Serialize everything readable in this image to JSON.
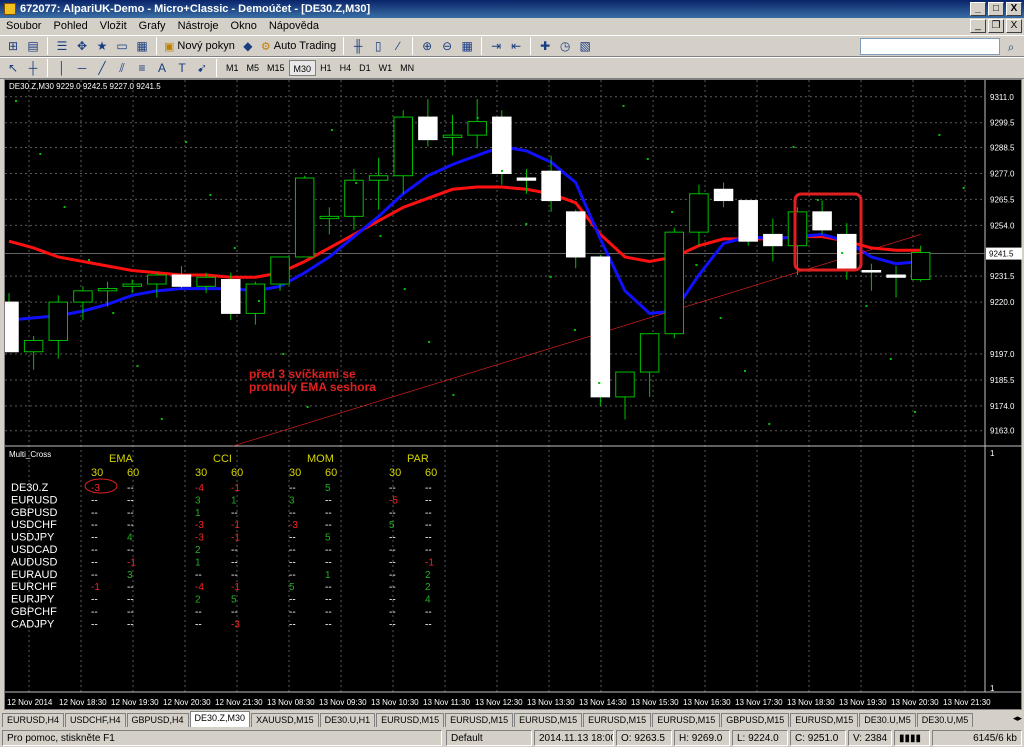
{
  "window": {
    "title": "672077: AlpariUK-Demo - Micro+Classic - Demoúčet - [DE30.Z,M30]",
    "btn_min": "_",
    "btn_max": "□",
    "btn_close": "X",
    "mdi_min": "_",
    "mdi_restore": "❐",
    "mdi_close": "X"
  },
  "menu": [
    "Soubor",
    "Pohled",
    "Vložit",
    "Grafy",
    "Nástroje",
    "Okno",
    "Nápověda"
  ],
  "toolbar": {
    "new_order": "Nový pokyn",
    "auto_trading": "Auto Trading",
    "timeframes": [
      "M1",
      "M5",
      "M15",
      "M30",
      "H1",
      "H4",
      "D1",
      "W1",
      "MN"
    ],
    "active_timeframe": "M30",
    "draw_text": "A",
    "draw_text_label": "T"
  },
  "chart": {
    "header": "DE30.Z,M30  9229.0 9242.5 9227.0 9241.5",
    "indicator_name": "Multi_Cross",
    "current_price": "9241.5",
    "price_labels": [
      "9311.0",
      "9299.5",
      "9288.5",
      "9277.0",
      "9265.5",
      "9254.0",
      "9231.5",
      "9220.0",
      "9197.0",
      "9185.5",
      "9174.0",
      "9163.0"
    ],
    "sub_scale": [
      "1",
      "1"
    ],
    "time_labels": [
      "12 Nov 2014",
      "12 Nov 18:30",
      "12 Nov 19:30",
      "12 Nov 20:30",
      "12 Nov 21:30",
      "13 Nov 08:30",
      "13 Nov 09:30",
      "13 Nov 10:30",
      "13 Nov 11:30",
      "13 Nov 12:30",
      "13 Nov 13:30",
      "13 Nov 14:30",
      "13 Nov 15:30",
      "13 Nov 16:30",
      "13 Nov 17:30",
      "13 Nov 18:30",
      "13 Nov 19:30",
      "13 Nov 20:30",
      "13 Nov 21:30"
    ],
    "annotation": "před 3 svíčkami se protnuly EMA seshora",
    "colors": {
      "bull": "#000000",
      "bear": "#ffffff",
      "wick": "#00c000",
      "ema_fast": "#1010ff",
      "ema_slow": "#ff1010",
      "annotation": "#e02020"
    }
  },
  "multicross": {
    "groups": [
      "EMA",
      "CCI",
      "MOM",
      "PAR"
    ],
    "periods": [
      "30",
      "60"
    ],
    "symbols": [
      "DE30.Z",
      "EURUSD",
      "GBPUSD",
      "USDCHF",
      "USDJPY",
      "USDCAD",
      "AUDUSD",
      "EURAUD",
      "EURCHF",
      "EURJPY",
      "GBPCHF",
      "CADJPY"
    ],
    "cells": [
      [
        {
          "t": "-3",
          "c": "r"
        },
        {
          "t": "--",
          "c": "w"
        },
        {
          "t": "-4",
          "c": "r"
        },
        {
          "t": "-1",
          "c": "r"
        },
        {
          "t": "--",
          "c": "w"
        },
        {
          "t": "5",
          "c": "g"
        },
        {
          "t": "--",
          "c": "w"
        },
        {
          "t": "--",
          "c": "w"
        }
      ],
      [
        {
          "t": "--",
          "c": "w"
        },
        {
          "t": "--",
          "c": "w"
        },
        {
          "t": "3",
          "c": "g"
        },
        {
          "t": "1",
          "c": "g"
        },
        {
          "t": "3",
          "c": "g"
        },
        {
          "t": "--",
          "c": "w"
        },
        {
          "t": "-5",
          "c": "r"
        },
        {
          "t": "--",
          "c": "w"
        }
      ],
      [
        {
          "t": "--",
          "c": "w"
        },
        {
          "t": "--",
          "c": "w"
        },
        {
          "t": "1",
          "c": "g"
        },
        {
          "t": "--",
          "c": "w"
        },
        {
          "t": "--",
          "c": "w"
        },
        {
          "t": "--",
          "c": "w"
        },
        {
          "t": "--",
          "c": "w"
        },
        {
          "t": "--",
          "c": "w"
        }
      ],
      [
        {
          "t": "--",
          "c": "w"
        },
        {
          "t": "--",
          "c": "w"
        },
        {
          "t": "-3",
          "c": "r"
        },
        {
          "t": "-1",
          "c": "r"
        },
        {
          "t": "-3",
          "c": "r"
        },
        {
          "t": "--",
          "c": "w"
        },
        {
          "t": "5",
          "c": "g"
        },
        {
          "t": "--",
          "c": "w"
        }
      ],
      [
        {
          "t": "--",
          "c": "w"
        },
        {
          "t": "4",
          "c": "g"
        },
        {
          "t": "-3",
          "c": "r"
        },
        {
          "t": "-1",
          "c": "r"
        },
        {
          "t": "--",
          "c": "w"
        },
        {
          "t": "5",
          "c": "g"
        },
        {
          "t": "--",
          "c": "w"
        },
        {
          "t": "--",
          "c": "w"
        }
      ],
      [
        {
          "t": "--",
          "c": "w"
        },
        {
          "t": "--",
          "c": "w"
        },
        {
          "t": "2",
          "c": "g"
        },
        {
          "t": "--",
          "c": "w"
        },
        {
          "t": "--",
          "c": "w"
        },
        {
          "t": "--",
          "c": "w"
        },
        {
          "t": "--",
          "c": "w"
        },
        {
          "t": "--",
          "c": "w"
        }
      ],
      [
        {
          "t": "--",
          "c": "w"
        },
        {
          "t": "-1",
          "c": "r"
        },
        {
          "t": "1",
          "c": "g"
        },
        {
          "t": "--",
          "c": "w"
        },
        {
          "t": "--",
          "c": "w"
        },
        {
          "t": "--",
          "c": "w"
        },
        {
          "t": "--",
          "c": "w"
        },
        {
          "t": "-1",
          "c": "r"
        }
      ],
      [
        {
          "t": "--",
          "c": "w"
        },
        {
          "t": "3",
          "c": "g"
        },
        {
          "t": "--",
          "c": "w"
        },
        {
          "t": "--",
          "c": "w"
        },
        {
          "t": "--",
          "c": "w"
        },
        {
          "t": "1",
          "c": "g"
        },
        {
          "t": "--",
          "c": "w"
        },
        {
          "t": "2",
          "c": "g"
        }
      ],
      [
        {
          "t": "-1",
          "c": "r"
        },
        {
          "t": "--",
          "c": "w"
        },
        {
          "t": "-4",
          "c": "r"
        },
        {
          "t": "-1",
          "c": "r"
        },
        {
          "t": "5",
          "c": "g"
        },
        {
          "t": "--",
          "c": "w"
        },
        {
          "t": "--",
          "c": "w"
        },
        {
          "t": "2",
          "c": "g"
        }
      ],
      [
        {
          "t": "--",
          "c": "w"
        },
        {
          "t": "--",
          "c": "w"
        },
        {
          "t": "2",
          "c": "g"
        },
        {
          "t": "5",
          "c": "g"
        },
        {
          "t": "--",
          "c": "w"
        },
        {
          "t": "--",
          "c": "w"
        },
        {
          "t": "--",
          "c": "w"
        },
        {
          "t": "4",
          "c": "g"
        }
      ],
      [
        {
          "t": "--",
          "c": "w"
        },
        {
          "t": "--",
          "c": "w"
        },
        {
          "t": "--",
          "c": "w"
        },
        {
          "t": "--",
          "c": "w"
        },
        {
          "t": "--",
          "c": "w"
        },
        {
          "t": "--",
          "c": "w"
        },
        {
          "t": "--",
          "c": "w"
        },
        {
          "t": "--",
          "c": "w"
        }
      ],
      [
        {
          "t": "--",
          "c": "w"
        },
        {
          "t": "--",
          "c": "w"
        },
        {
          "t": "--",
          "c": "w"
        },
        {
          "t": "-3",
          "c": "r"
        },
        {
          "t": "--",
          "c": "w"
        },
        {
          "t": "--",
          "c": "w"
        },
        {
          "t": "--",
          "c": "w"
        },
        {
          "t": "--",
          "c": "w"
        }
      ]
    ],
    "colors": {
      "header": "#d4d400",
      "symbol": "#ffffff",
      "r": "#ff2020",
      "g": "#20b020",
      "w": "#ffffff"
    }
  },
  "chart_data": {
    "type": "candlestick",
    "ylim": [
      9158,
      9314
    ],
    "candles": [
      [
        9220,
        9224,
        9199,
        9198
      ],
      [
        9198,
        9205,
        9190,
        9203
      ],
      [
        9203,
        9223,
        9195,
        9220
      ],
      [
        9220,
        9227,
        9212,
        9225
      ],
      [
        9225,
        9229,
        9218,
        9226
      ],
      [
        9227,
        9230,
        9224,
        9228
      ],
      [
        9228,
        9233,
        9222,
        9232
      ],
      [
        9232,
        9236,
        9226,
        9227
      ],
      [
        9227,
        9233,
        9224,
        9231
      ],
      [
        9230,
        9233,
        9212,
        9215
      ],
      [
        9215,
        9229,
        9210,
        9228
      ],
      [
        9228,
        9240,
        9225,
        9240
      ],
      [
        9240,
        9276,
        9240,
        9275
      ],
      [
        9257,
        9262,
        9250,
        9258
      ],
      [
        9258,
        9279,
        9252,
        9274
      ],
      [
        9274,
        9284,
        9261,
        9276
      ],
      [
        9276,
        9305,
        9268,
        9302
      ],
      [
        9302,
        9310,
        9289,
        9292
      ],
      [
        9293,
        9303,
        9285,
        9294
      ],
      [
        9294,
        9310,
        9288,
        9300
      ],
      [
        9302,
        9305,
        9272,
        9277
      ],
      [
        9275,
        9279,
        9268,
        9274
      ],
      [
        9278,
        9285,
        9260,
        9265
      ],
      [
        9260,
        9261,
        9235,
        9240
      ],
      [
        9240,
        9241,
        9174,
        9178
      ],
      [
        9178,
        9184,
        9168,
        9189
      ],
      [
        9189,
        9196,
        9178,
        9206
      ],
      [
        9206,
        9253,
        9204,
        9251
      ],
      [
        9251,
        9272,
        9245,
        9268
      ],
      [
        9270,
        9273,
        9262,
        9265
      ],
      [
        9265,
        9263,
        9245,
        9247
      ],
      [
        9250,
        9257,
        9238,
        9245
      ],
      [
        9245,
        9262,
        9232,
        9260
      ],
      [
        9260,
        9265,
        9250,
        9252
      ],
      [
        9250,
        9255,
        9230,
        9234
      ],
      [
        9234,
        9237,
        9225,
        9234
      ],
      [
        9232,
        9236,
        9222,
        9231
      ],
      [
        9230,
        9245,
        9229,
        9242
      ]
    ],
    "ema30": [
      9212,
      9213,
      9214,
      9216,
      9219,
      9223,
      9225,
      9226,
      9226,
      9226,
      9225,
      9227,
      9233,
      9240,
      9249,
      9258,
      9268,
      9276,
      9281,
      9285,
      9289,
      9287,
      9282,
      9273,
      9248,
      9225,
      9215,
      9216,
      9232,
      9246,
      9249,
      9248,
      9249,
      9250,
      9247,
      9240,
      9237,
      9238
    ],
    "ema60": [
      9247,
      9244,
      9240,
      9238,
      9236,
      9234,
      9233,
      9232,
      9232,
      9231,
      9231,
      9233,
      9238,
      9244,
      9250,
      9256,
      9262,
      9266,
      9270,
      9271,
      9271,
      9270,
      9268,
      9264,
      9250,
      9240,
      9238,
      9240,
      9245,
      9248,
      9248,
      9248,
      9249,
      9249,
      9247,
      9244,
      9243,
      9243
    ],
    "trendline": [
      [
        9220,
        0
      ],
      [
        9250,
        37
      ]
    ]
  }
}
